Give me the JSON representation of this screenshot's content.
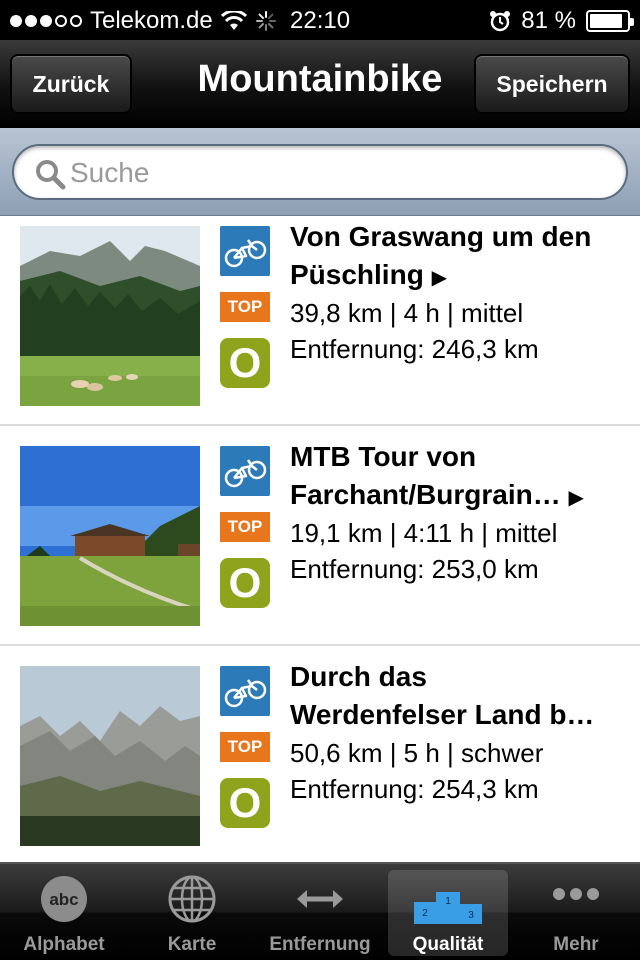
{
  "status": {
    "carrier": "Telekom.de",
    "time": "22:10",
    "battery": "81 %"
  },
  "nav": {
    "back_label": "Zurück",
    "title": "Mountainbike",
    "save_label": "Speichern"
  },
  "search": {
    "placeholder": "Suche"
  },
  "items": [
    {
      "title_line1": "Von Graswang um den",
      "title_line2": "Püschling",
      "stats": "39,8 km | 4 h | mittel",
      "distance": "Entfernung: 246,3 km",
      "top_label": "TOP",
      "o_label": "O"
    },
    {
      "title_line1": "MTB Tour von",
      "title_line2": "Farchant/Burgrain…",
      "stats": "19,1 km | 4:11 h | mittel",
      "distance": "Entfernung: 253,0 km",
      "top_label": "TOP",
      "o_label": "O"
    },
    {
      "title_line1": "Durch das",
      "title_line2": "Werdenfelser Land b…",
      "stats": "50,6 km | 5 h | schwer",
      "distance": "Entfernung: 254,3 km",
      "top_label": "TOP",
      "o_label": "O"
    }
  ],
  "tabs": [
    {
      "label": "Alphabet",
      "icon": "abc-icon"
    },
    {
      "label": "Karte",
      "icon": "globe-icon"
    },
    {
      "label": "Entfernung",
      "icon": "arrows-icon"
    },
    {
      "label": "Qualität",
      "icon": "podium-icon",
      "active": true
    },
    {
      "label": "Mehr",
      "icon": "more-icon"
    }
  ],
  "tab_icon_texts": {
    "abc": "abc",
    "podium_1": "1",
    "podium_2": "2",
    "podium_3": "3"
  },
  "colors": {
    "bike_badge": "#2d7ab8",
    "top_badge": "#e8761c",
    "o_badge": "#8fa41c"
  }
}
